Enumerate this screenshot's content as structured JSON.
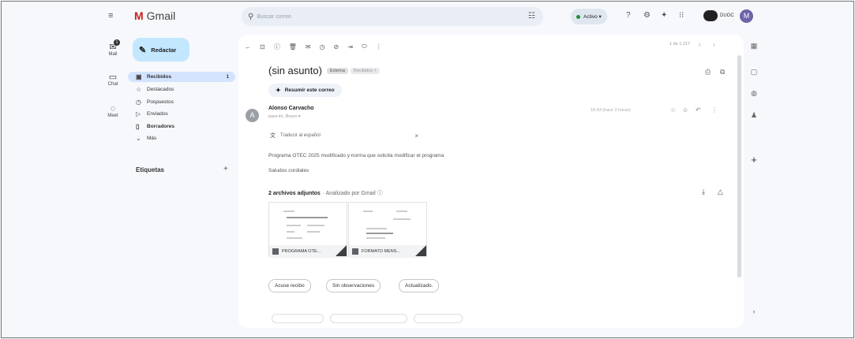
{
  "app": {
    "name": "Gmail",
    "logo_letter": "M"
  },
  "rail": {
    "items": [
      {
        "label": "Mail",
        "icon": "mail-icon"
      },
      {
        "label": "Chat",
        "icon": "chat-icon"
      },
      {
        "label": "Meet",
        "icon": "video-icon"
      }
    ],
    "badge": "1"
  },
  "search": {
    "placeholder": "Buscar correo"
  },
  "header": {
    "status_label": "Activo",
    "org_label": "DUOC",
    "avatar_letter": "M"
  },
  "nav": {
    "compose_label": "Redactar",
    "items": [
      {
        "label": "Recibidos",
        "count": "1",
        "icon": "inbox-icon"
      },
      {
        "label": "Destacados",
        "icon": "star-icon"
      },
      {
        "label": "Pospuestos",
        "icon": "clock-icon"
      },
      {
        "label": "Enviados",
        "icon": "send-icon"
      },
      {
        "label": "Borradores",
        "icon": "draft-icon"
      },
      {
        "label": "Más",
        "icon": "chevron-down-icon"
      }
    ],
    "labels_title": "Etiquetas"
  },
  "toolbar": {
    "page_info": "1 de 1.217"
  },
  "email": {
    "subject": "(sin asunto)",
    "chips": [
      "Externa",
      "Recibidos ×"
    ],
    "summary_label": "Resumir este correo",
    "sender": "Alonso Carvacho",
    "to": "para mí, Bruno ▾",
    "date": "16:43 (hace 2 horas)",
    "translate_label": "Traducir al español",
    "body_line1": "Programa OTEC 2025 modificado y norma que solicita modificar el programa",
    "body_line2": "Saludos cordiales",
    "attachments_header": "2 archivos adjuntos",
    "attachments_scan": "· Analizado por Gmail ⓘ",
    "attachments": [
      {
        "name": "PROGRAMA OTE..."
      },
      {
        "name": "FORMATO MENS..."
      }
    ],
    "replies": [
      "Acuse recibo",
      "Sin observaciones",
      "Actualizado."
    ]
  }
}
